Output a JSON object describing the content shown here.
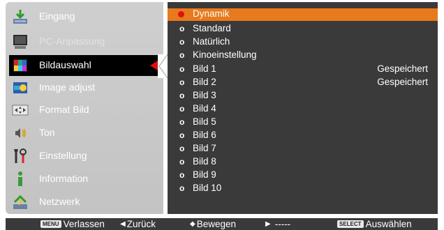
{
  "menu": {
    "items": [
      {
        "label": "Eingang",
        "icon": "input-icon",
        "state": "normal"
      },
      {
        "label": "PC-Anpassung",
        "icon": "pc-adjust-icon",
        "state": "disabled"
      },
      {
        "label": "Bildauswahl",
        "icon": "image-select-icon",
        "state": "selected"
      },
      {
        "label": "Image adjust",
        "icon": "image-adjust-icon",
        "state": "normal"
      },
      {
        "label": "Format Bild",
        "icon": "screen-format-icon",
        "state": "normal"
      },
      {
        "label": "Ton",
        "icon": "sound-icon",
        "state": "normal"
      },
      {
        "label": "Einstellung",
        "icon": "setting-icon",
        "state": "normal"
      },
      {
        "label": "Information",
        "icon": "information-icon",
        "state": "normal"
      },
      {
        "label": "Netzwerk",
        "icon": "network-icon",
        "state": "normal"
      }
    ]
  },
  "list": {
    "items": [
      {
        "label": "Dynamik",
        "status": ""
      },
      {
        "label": "Standard",
        "status": ""
      },
      {
        "label": "Natürlich",
        "status": ""
      },
      {
        "label": "Kinoeinstellung",
        "status": ""
      },
      {
        "label": "Bild 1",
        "status": "Gespeichert"
      },
      {
        "label": "Bild 2",
        "status": "Gespeichert"
      },
      {
        "label": "Bild 3",
        "status": ""
      },
      {
        "label": "Bild 4",
        "status": ""
      },
      {
        "label": "Bild 5",
        "status": ""
      },
      {
        "label": "Bild 6",
        "status": ""
      },
      {
        "label": "Bild 7",
        "status": ""
      },
      {
        "label": "Bild 8",
        "status": ""
      },
      {
        "label": "Bild 9",
        "status": ""
      },
      {
        "label": "Bild 10",
        "status": ""
      }
    ],
    "bullet": "o",
    "active_index": 0
  },
  "footer": {
    "menu_key": "MENU",
    "exit": "Verlassen",
    "back": "Zurück",
    "move": "Bewegen",
    "next": "-----",
    "select_key": "SELECT",
    "select": "Auswählen"
  },
  "colors": {
    "highlight": "#e8791c",
    "pointer": "#e01010",
    "panel": "#3a3a3a",
    "menu": "#c8c8c8"
  }
}
